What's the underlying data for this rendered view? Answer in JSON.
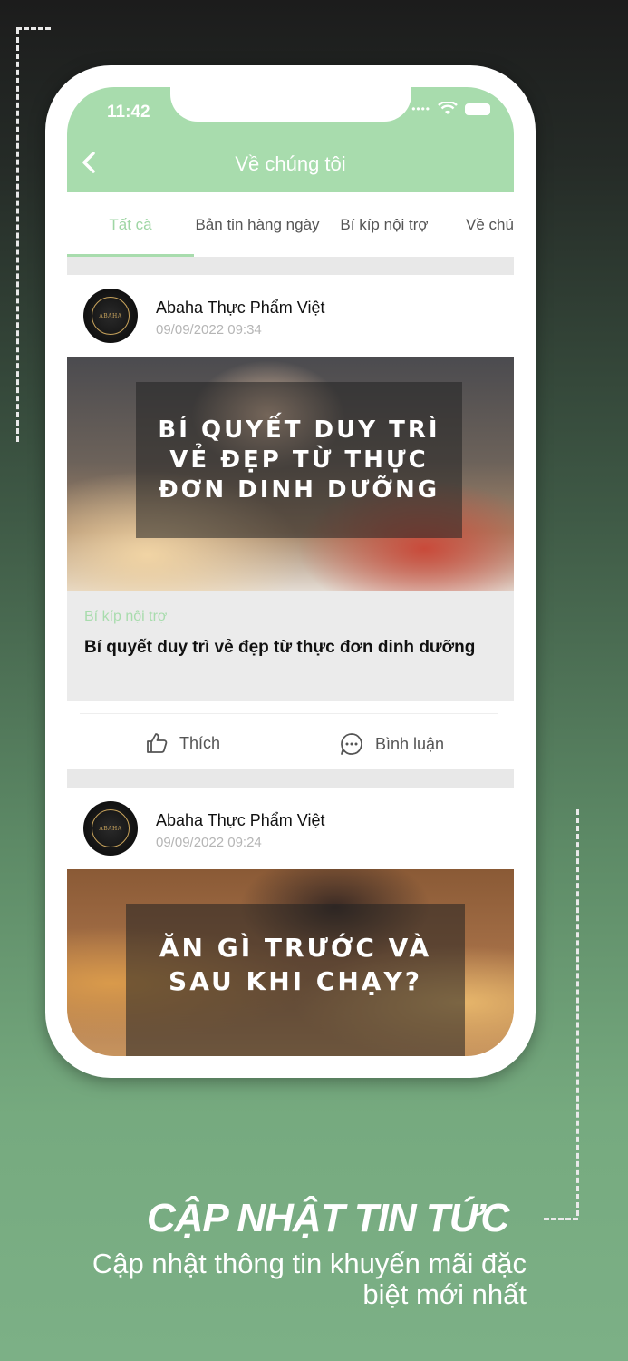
{
  "status_bar": {
    "time": "11:42"
  },
  "header": {
    "title": "Về chúng tôi"
  },
  "tabs": [
    {
      "label": "Tất cà",
      "active": true
    },
    {
      "label": "Bản tin hàng ngày",
      "active": false
    },
    {
      "label": "Bí kíp nội trợ",
      "active": false
    },
    {
      "label": "Về chú",
      "active": false
    }
  ],
  "posts": [
    {
      "author": "Abaha Thực Phẩm Việt",
      "date": "09/09/2022 09:34",
      "avatar_text": "ABAHA",
      "image_headline": "BÍ QUYẾT DUY TRÌ VẺ ĐẸP TỪ THỰC ĐƠN DINH DƯỠNG",
      "category": "Bí kíp nội trợ",
      "title": "Bí quyết duy trì vẻ đẹp từ thực đơn dinh dưỡng",
      "actions": {
        "like": "Thích",
        "comment": "Bình luận"
      }
    },
    {
      "author": "Abaha Thực Phẩm Việt",
      "date": "09/09/2022 09:24",
      "avatar_text": "ABAHA",
      "image_headline": "ĂN GÌ TRƯỚC VÀ SAU KHI CHẠY?"
    }
  ],
  "promo": {
    "title": "CẬP NHẬT TIN TỨC",
    "subtitle": "Cập nhật thông tin khuyến mãi đặc biệt mới nhất"
  },
  "colors": {
    "accent": "#a8dcad",
    "header_bg": "#a8dcad",
    "category_text": "#a8dcad"
  },
  "icons": [
    "back-icon",
    "wifi-icon",
    "battery-icon",
    "like-icon",
    "comment-icon"
  ]
}
